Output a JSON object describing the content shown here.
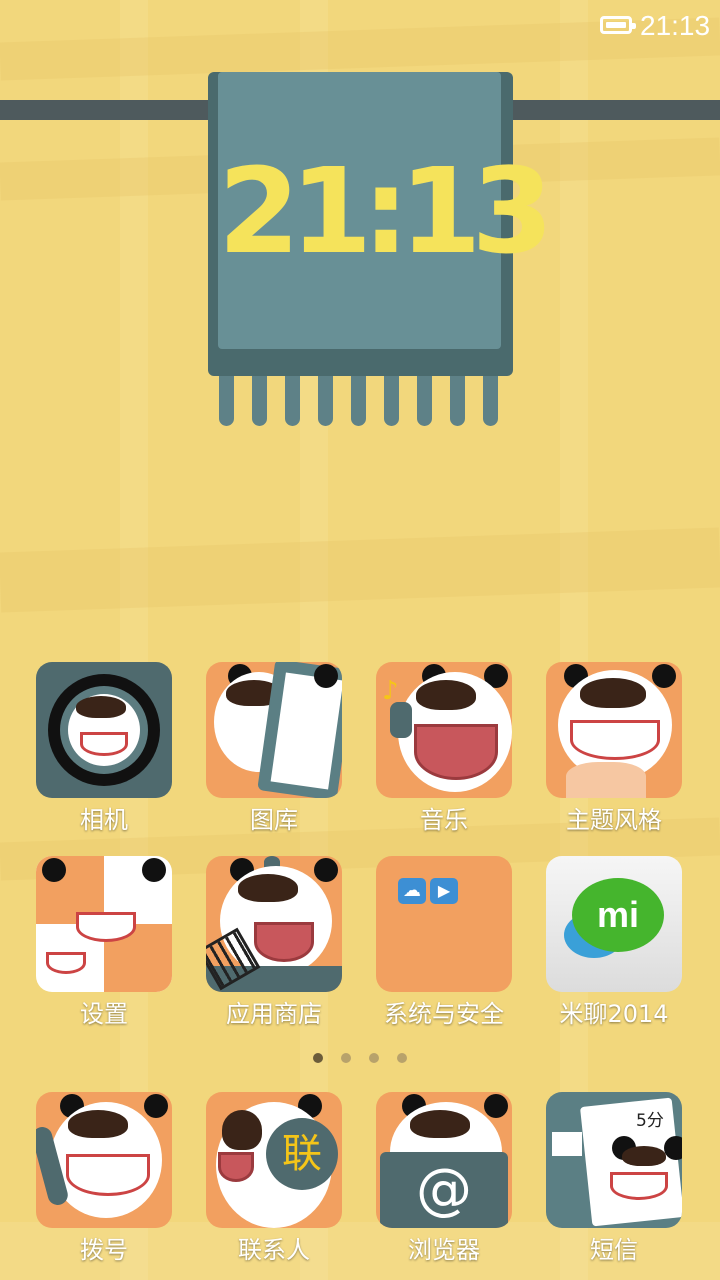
{
  "status_bar": {
    "time": "21:13",
    "battery_icon": "battery-full-icon"
  },
  "clock_widget": {
    "time": "21:13"
  },
  "apps": [
    {
      "label": "相机",
      "icon": "camera-icon"
    },
    {
      "label": "图库",
      "icon": "gallery-icon"
    },
    {
      "label": "音乐",
      "icon": "music-icon"
    },
    {
      "label": "主题风格",
      "icon": "theme-icon"
    },
    {
      "label": "设置",
      "icon": "settings-icon"
    },
    {
      "label": "应用商店",
      "icon": "app-store-icon"
    },
    {
      "label": "系统与安全",
      "icon": "system-security-folder-icon"
    },
    {
      "label": "米聊2014",
      "icon": "miliao-icon"
    }
  ],
  "page_indicator": {
    "count": 4,
    "active_index": 0
  },
  "dock": [
    {
      "label": "拨号",
      "icon": "phone-dialer-icon"
    },
    {
      "label": "联系人",
      "icon": "contacts-icon",
      "badge_text": "联"
    },
    {
      "label": "浏览器",
      "icon": "browser-icon",
      "badge_text": "@"
    },
    {
      "label": "短信",
      "icon": "messages-icon",
      "badge_text": "5分"
    }
  ],
  "colors": {
    "wallpaper": "#f2d77c",
    "clock_digits": "#f5e35b",
    "clock_face": "#689096",
    "icon_bg": "#f2a060"
  }
}
